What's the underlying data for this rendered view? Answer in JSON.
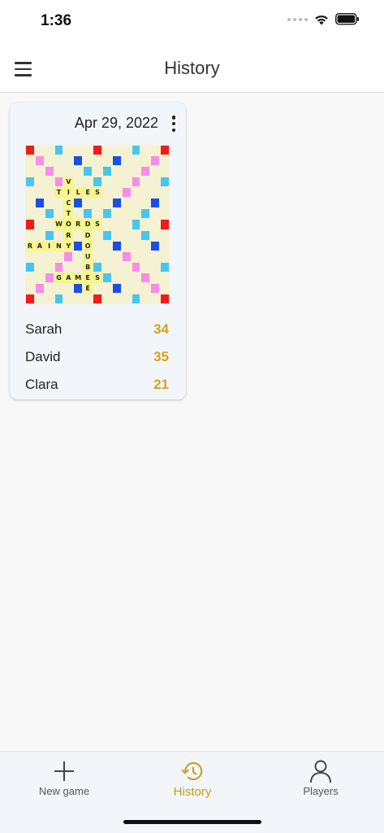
{
  "status_bar": {
    "time": "1:36",
    "icons": [
      "signal-dots-icon",
      "wifi-icon",
      "battery-icon"
    ]
  },
  "app_bar": {
    "title": "History",
    "menu_icon": "menu-icon"
  },
  "colors": {
    "accent": "#d4a21c",
    "triple_word": "#f21a1a",
    "double_word": "#f88de8",
    "triple_letter": "#1a4fe6",
    "double_letter": "#47c6ef",
    "board": "#f4f2d2",
    "tile": "#f7f58f"
  },
  "games": [
    {
      "date": "Apr 29, 2022",
      "board_words": [
        "VICTORY",
        "TILES",
        "WORDS",
        "RAINY",
        "DOUBLE",
        "GAMES"
      ],
      "players": [
        {
          "name": "Sarah",
          "score": "34"
        },
        {
          "name": "David",
          "score": "35"
        },
        {
          "name": "Clara",
          "score": "21"
        }
      ]
    }
  ],
  "nav": {
    "items": [
      {
        "label": "New game",
        "icon": "plus-icon",
        "active": false
      },
      {
        "label": "History",
        "icon": "history-icon",
        "active": true
      },
      {
        "label": "Players",
        "icon": "person-icon",
        "active": false
      }
    ]
  }
}
